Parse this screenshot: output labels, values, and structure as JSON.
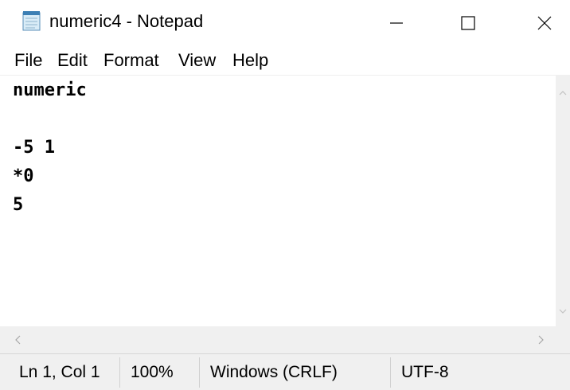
{
  "window": {
    "title": "numeric4 - Notepad",
    "icon": "notepad-icon",
    "controls": {
      "minimize": "minimize-icon",
      "maximize": "maximize-icon",
      "close": "close-icon"
    }
  },
  "menu": {
    "file": "File",
    "edit": "Edit",
    "format": "Format",
    "view": "View",
    "help": "Help"
  },
  "editor": {
    "lines": [
      "numeric",
      "",
      "-5 1",
      "*0",
      "5"
    ]
  },
  "status": {
    "position": "Ln 1, Col 1",
    "zoom": "100%",
    "line_ending": "Windows (CRLF)",
    "encoding": "UTF-8"
  },
  "colors": {
    "chrome_gray": "#f0f0f0",
    "text": "#000000"
  }
}
